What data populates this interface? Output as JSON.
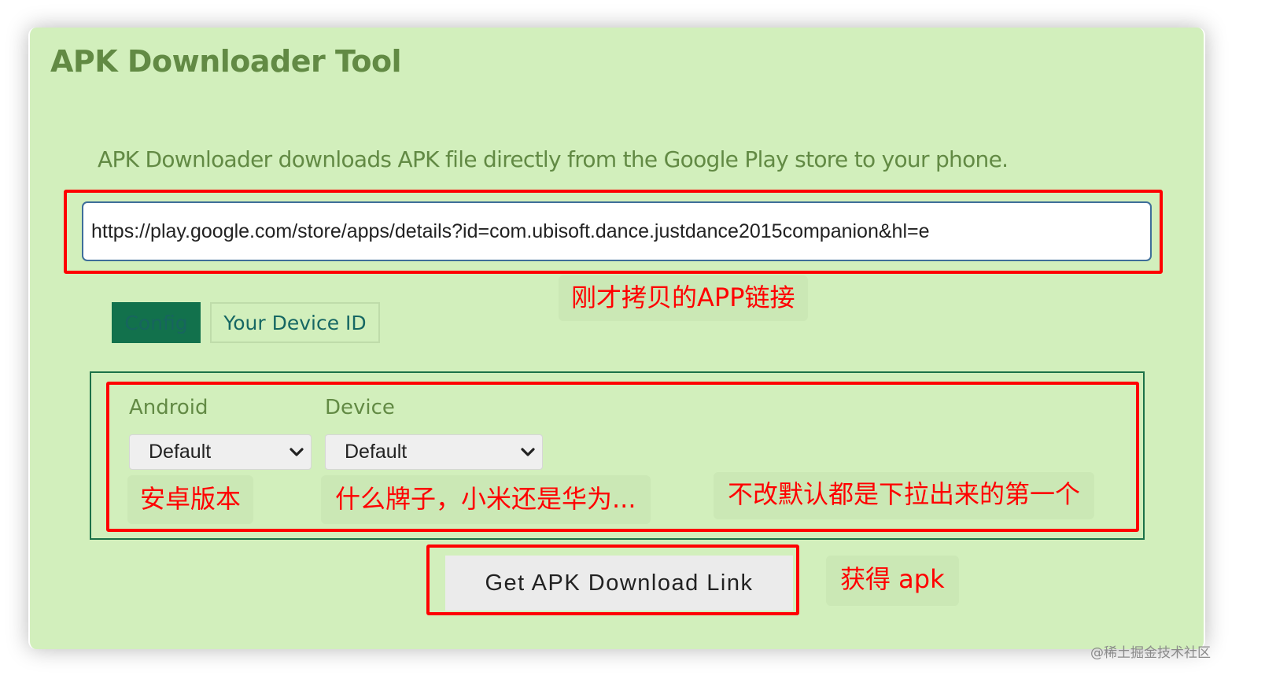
{
  "page": {
    "title": "APK Downloader Tool",
    "description": "APK Downloader downloads APK file directly from the Google Play store to your phone."
  },
  "url_input": {
    "value": "https://play.google.com/store/apps/details?id=com.ubisoft.dance.justdance2015companion&hl=e",
    "placeholder": ""
  },
  "tabs": [
    {
      "label": "Config",
      "active": true
    },
    {
      "label": "Your Device ID",
      "active": false
    }
  ],
  "config": {
    "android_label": "Android",
    "android_selected": "Default",
    "device_label": "Device",
    "device_selected": "Default"
  },
  "actions": {
    "get_link_label": "Get APK Download Link"
  },
  "annotations": {
    "url_note": "刚才拷贝的APP链接",
    "android_note": "安卓版本",
    "device_note": "什么牌子，小米还是华为...",
    "default_note": "不改默认都是下拉出来的第一个",
    "button_note": "获得 apk"
  },
  "watermark": "@稀土掘金技术社区",
  "colors": {
    "card_bg": "#d2efbc",
    "heading_green": "#628a44",
    "active_tab_bg": "#12714c",
    "annotation_red": "#ff0000",
    "input_border": "#3e6e9a"
  },
  "icons": {
    "select_arrow": "chevron-down-icon"
  }
}
